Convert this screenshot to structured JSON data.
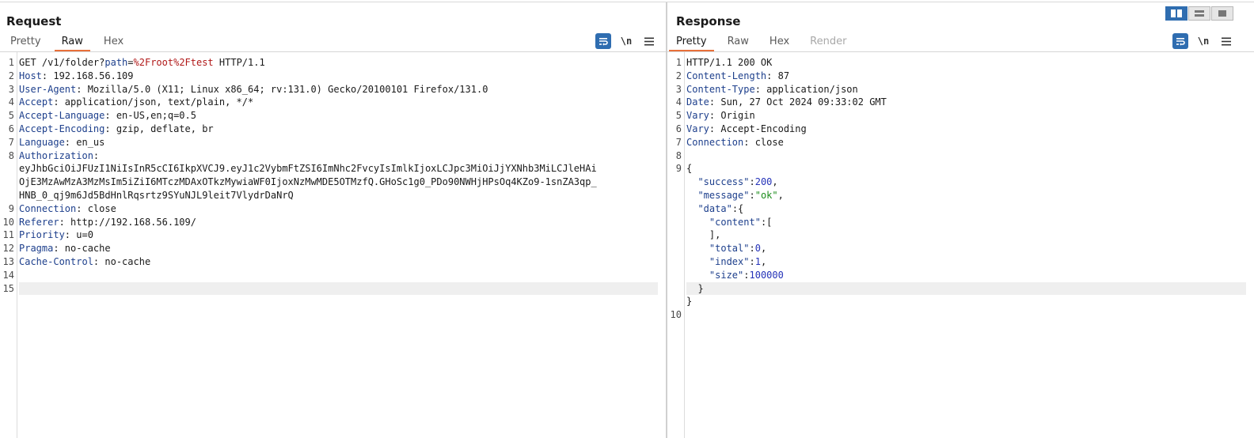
{
  "request": {
    "title": "Request",
    "tabs": [
      "Pretty",
      "Raw",
      "Hex"
    ],
    "active_tab": 1,
    "lines": [
      {
        "n": "1",
        "parts": [
          {
            "c": "pl",
            "t": "GET /v1/folder?"
          },
          {
            "c": "qn",
            "t": "path"
          },
          {
            "c": "pl",
            "t": "="
          },
          {
            "c": "qv",
            "t": "%2Froot%2Ftest"
          },
          {
            "c": "pl",
            "t": " HTTP/1.1"
          }
        ]
      },
      {
        "n": "2",
        "parts": [
          {
            "c": "hk",
            "t": "Host"
          },
          {
            "c": "pl",
            "t": ": 192.168.56.109"
          }
        ]
      },
      {
        "n": "3",
        "parts": [
          {
            "c": "hk",
            "t": "User-Agent"
          },
          {
            "c": "pl",
            "t": ": Mozilla/5.0 (X11; Linux x86_64; rv:131.0) Gecko/20100101 Firefox/131.0"
          }
        ]
      },
      {
        "n": "4",
        "parts": [
          {
            "c": "hk",
            "t": "Accept"
          },
          {
            "c": "pl",
            "t": ": application/json, text/plain, */*"
          }
        ]
      },
      {
        "n": "5",
        "parts": [
          {
            "c": "hk",
            "t": "Accept-Language"
          },
          {
            "c": "pl",
            "t": ": en-US,en;q=0.5"
          }
        ]
      },
      {
        "n": "6",
        "parts": [
          {
            "c": "hk",
            "t": "Accept-Encoding"
          },
          {
            "c": "pl",
            "t": ": gzip, deflate, br"
          }
        ]
      },
      {
        "n": "7",
        "parts": [
          {
            "c": "hk",
            "t": "Language"
          },
          {
            "c": "pl",
            "t": ": en_us"
          }
        ]
      },
      {
        "n": "8",
        "parts": [
          {
            "c": "hk",
            "t": "Authorization"
          },
          {
            "c": "pl",
            "t": ":"
          }
        ]
      },
      {
        "n": "",
        "parts": [
          {
            "c": "pl",
            "t": "eyJhbGciOiJFUzI1NiIsInR5cCI6IkpXVCJ9.eyJ1c2VybmFtZSI6ImNhc2FvcyIsImlkIjoxLCJpc3MiOiJjYXNhb3MiLCJleHAi"
          }
        ]
      },
      {
        "n": "",
        "parts": [
          {
            "c": "pl",
            "t": "OjE3MzAwMzA3MzMsIm5iZiI6MTczMDAxOTkzMywiaWF0IjoxNzMwMDE5OTMzfQ.GHoSc1g0_PDo90NWHjHPsOq4KZo9-1snZA3qp_"
          }
        ]
      },
      {
        "n": "",
        "parts": [
          {
            "c": "pl",
            "t": "HNB_0_qj9m6Jd5BdHnlRqsrtz9SYuNJL9leit7VlydrDaNrQ"
          }
        ]
      },
      {
        "n": "9",
        "parts": [
          {
            "c": "hk",
            "t": "Connection"
          },
          {
            "c": "pl",
            "t": ": close"
          }
        ]
      },
      {
        "n": "10",
        "parts": [
          {
            "c": "hk",
            "t": "Referer"
          },
          {
            "c": "pl",
            "t": ": http://192.168.56.109/"
          }
        ]
      },
      {
        "n": "11",
        "parts": [
          {
            "c": "hk",
            "t": "Priority"
          },
          {
            "c": "pl",
            "t": ": u=0"
          }
        ]
      },
      {
        "n": "12",
        "parts": [
          {
            "c": "hk",
            "t": "Pragma"
          },
          {
            "c": "pl",
            "t": ": no-cache"
          }
        ]
      },
      {
        "n": "13",
        "parts": [
          {
            "c": "hk",
            "t": "Cache-Control"
          },
          {
            "c": "pl",
            "t": ": no-cache"
          }
        ]
      },
      {
        "n": "14",
        "parts": []
      },
      {
        "n": "15",
        "parts": [],
        "current": true
      }
    ]
  },
  "response": {
    "title": "Response",
    "tabs": [
      "Pretty",
      "Raw",
      "Hex",
      "Render"
    ],
    "active_tab": 0,
    "disabled_tab": 3,
    "lines": [
      {
        "n": "1",
        "parts": [
          {
            "c": "pl",
            "t": "HTTP/1.1 200 OK"
          }
        ]
      },
      {
        "n": "2",
        "parts": [
          {
            "c": "hk",
            "t": "Content-Length"
          },
          {
            "c": "pl",
            "t": ": 87"
          }
        ]
      },
      {
        "n": "3",
        "parts": [
          {
            "c": "hk",
            "t": "Content-Type"
          },
          {
            "c": "pl",
            "t": ": application/json"
          }
        ]
      },
      {
        "n": "4",
        "parts": [
          {
            "c": "hk",
            "t": "Date"
          },
          {
            "c": "pl",
            "t": ": Sun, 27 Oct 2024 09:33:02 GMT"
          }
        ]
      },
      {
        "n": "5",
        "parts": [
          {
            "c": "hk",
            "t": "Vary"
          },
          {
            "c": "pl",
            "t": ": Origin"
          }
        ]
      },
      {
        "n": "6",
        "parts": [
          {
            "c": "hk",
            "t": "Vary"
          },
          {
            "c": "pl",
            "t": ": Accept-Encoding"
          }
        ]
      },
      {
        "n": "7",
        "parts": [
          {
            "c": "hk",
            "t": "Connection"
          },
          {
            "c": "pl",
            "t": ": close"
          }
        ]
      },
      {
        "n": "8",
        "parts": []
      },
      {
        "n": "9",
        "parts": [
          {
            "c": "pl",
            "t": "{"
          }
        ]
      },
      {
        "n": "",
        "parts": [
          {
            "c": "pl",
            "t": "  "
          },
          {
            "c": "jk",
            "t": "\"success\""
          },
          {
            "c": "pl",
            "t": ":"
          },
          {
            "c": "jn",
            "t": "200"
          },
          {
            "c": "pl",
            "t": ","
          }
        ]
      },
      {
        "n": "",
        "parts": [
          {
            "c": "pl",
            "t": "  "
          },
          {
            "c": "jk",
            "t": "\"message\""
          },
          {
            "c": "pl",
            "t": ":"
          },
          {
            "c": "js",
            "t": "\"ok\""
          },
          {
            "c": "pl",
            "t": ","
          }
        ]
      },
      {
        "n": "",
        "parts": [
          {
            "c": "pl",
            "t": "  "
          },
          {
            "c": "jk",
            "t": "\"data\""
          },
          {
            "c": "pl",
            "t": ":{"
          }
        ]
      },
      {
        "n": "",
        "parts": [
          {
            "c": "pl",
            "t": "    "
          },
          {
            "c": "jk",
            "t": "\"content\""
          },
          {
            "c": "pl",
            "t": ":["
          }
        ]
      },
      {
        "n": "",
        "parts": [
          {
            "c": "pl",
            "t": "    ],"
          }
        ]
      },
      {
        "n": "",
        "parts": [
          {
            "c": "pl",
            "t": "    "
          },
          {
            "c": "jk",
            "t": "\"total\""
          },
          {
            "c": "pl",
            "t": ":"
          },
          {
            "c": "jn",
            "t": "0"
          },
          {
            "c": "pl",
            "t": ","
          }
        ]
      },
      {
        "n": "",
        "parts": [
          {
            "c": "pl",
            "t": "    "
          },
          {
            "c": "jk",
            "t": "\"index\""
          },
          {
            "c": "pl",
            "t": ":"
          },
          {
            "c": "jn",
            "t": "1"
          },
          {
            "c": "pl",
            "t": ","
          }
        ]
      },
      {
        "n": "",
        "parts": [
          {
            "c": "pl",
            "t": "    "
          },
          {
            "c": "jk",
            "t": "\"size\""
          },
          {
            "c": "pl",
            "t": ":"
          },
          {
            "c": "jn",
            "t": "100000"
          }
        ]
      },
      {
        "n": "",
        "parts": [
          {
            "c": "pl",
            "t": "  }"
          }
        ],
        "current": true
      },
      {
        "n": "",
        "parts": [
          {
            "c": "pl",
            "t": "}"
          }
        ]
      },
      {
        "n": "10",
        "parts": []
      }
    ]
  },
  "toolbar": {
    "icons": [
      "word-wrap-icon",
      "newline-icon",
      "menu-icon"
    ],
    "newline_label": "\\n"
  },
  "view_switch": {
    "icons": [
      "split-horizontal-icon",
      "split-vertical-icon",
      "single-pane-icon"
    ],
    "active": 0
  },
  "colors": {
    "accent": "#e8703a",
    "header_key": "#1d3f8c",
    "param_value": "#b01818",
    "json_number": "#2432b8",
    "json_string": "#1a8c1a",
    "active_button": "#2f6db0"
  }
}
